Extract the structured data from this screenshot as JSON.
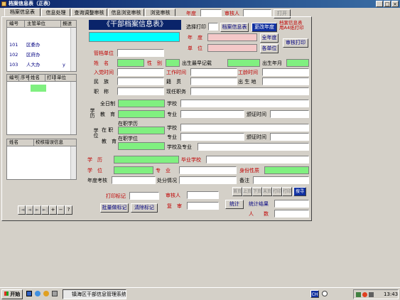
{
  "window": {
    "title": "档案信息表（正表）",
    "ctrl_min": "_",
    "ctrl_max": "□",
    "ctrl_close": "×"
  },
  "tabs": [
    {
      "label": "档案信息表"
    },
    {
      "label": "信息处理"
    },
    {
      "label": "查询调整审核"
    },
    {
      "label": "信息浏览审核"
    },
    {
      "label": "浏览审核"
    }
  ],
  "header_fields": {
    "year_label": "年度",
    "auditor_label": "审核人",
    "lock_button": "打开"
  },
  "left_grid1": {
    "headers": [
      "编号",
      "主管单位",
      "报送"
    ],
    "rows": [
      [
        "101",
        "区委办",
        ""
      ],
      [
        "102",
        "区府办",
        ""
      ],
      [
        "103",
        "人大办",
        "y"
      ]
    ]
  },
  "left_grid2": {
    "headers": [
      "编号",
      "序号",
      "姓名",
      "打印",
      "单位"
    ]
  },
  "left_grid3": {
    "headers": [
      "姓名",
      "校核错误信息"
    ]
  },
  "nav_buttons": [
    "|◄",
    "◄",
    "►",
    "►|",
    "+",
    "−",
    "?"
  ],
  "form": {
    "title": "《干部档案信息表》",
    "select_print_label": "选择打印",
    "archive_btn": "档案信息表",
    "change_year_btn": "更改年度",
    "note": "档案信息表\n用A4纸打印",
    "all_year_btn": "全年度",
    "year_label": "年　度",
    "unit_label": "单　位",
    "each_unit_btn": "各单位",
    "audit_print_btn": "审核打印",
    "manage_unit": "管档单位",
    "name": "姓　名",
    "gender": "性　别",
    "earliest_birth": "出生最早记载",
    "birth_ym": "出生年月",
    "join_party": "入党时间",
    "work_time": "工作时间",
    "seniority_time": "工龄时间",
    "ethnicity": "民　族",
    "native": "籍　贯",
    "birthplace": "出 生 地",
    "post": "职　称",
    "current_post": "现任职务",
    "edu_label": "学历",
    "fulltime": "全日制",
    "education": "教　育",
    "school": "学校",
    "major": "专业",
    "cert_time": "颁证时间",
    "degree_label": "学位",
    "onjob": "在 职",
    "onjob_edu": "在职学历",
    "onjob_degree": "在职学位",
    "school_major": "学校及专业",
    "xueli": "学　历",
    "graduate_school": "毕业学校",
    "xuewei": "学　位",
    "zhuanye": "专　业",
    "identity": "身份性质",
    "annual_review": "年度考核",
    "punishment": "处分情况",
    "remarks": "备注",
    "print_mark_btn": "打印标记",
    "batch_mark_btn": "批量做标记",
    "clear_mark_btn": "清除标记",
    "auditor": "审核人",
    "recheck": "复　审",
    "stats_btn": "统计",
    "stats_result": "统计结果",
    "people_count": "人　　数",
    "record_nav": [
      "首页",
      "上页",
      "下页",
      "末页",
      "打印",
      "打印",
      "搜寻"
    ]
  },
  "taskbar": {
    "start": "开始",
    "task": "镇海区干部信息管理系统",
    "ime": "CH",
    "time": "13:43"
  },
  "colors": {
    "accent": "#0000c0",
    "field_green": "#80f080",
    "field_pink": "#f4c8c8",
    "title_bg": "#0a246a",
    "cyan": "#00ffff"
  }
}
